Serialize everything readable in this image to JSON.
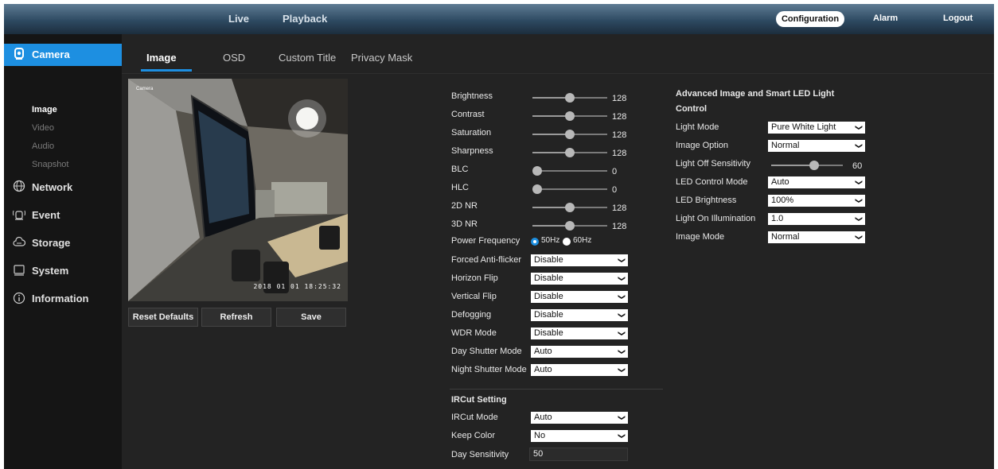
{
  "topnav": {
    "live": "Live",
    "playback": "Playback",
    "configuration": "Configuration",
    "alarm": "Alarm",
    "logout": "Logout"
  },
  "tabs": [
    "Image",
    "OSD",
    "Custom Title",
    "Privacy Mask"
  ],
  "sidebar": {
    "camera": "Camera",
    "camera_items": [
      "Image",
      "Video",
      "Audio",
      "Snapshot"
    ],
    "network": "Network",
    "event": "Event",
    "storage": "Storage",
    "system": "System",
    "information": "Information"
  },
  "preview": {
    "timestamp": "2018 01 01  18:25:32",
    "label": "Camera"
  },
  "buttons": {
    "reset": "Reset Defaults",
    "refresh": "Refresh",
    "save": "Save"
  },
  "image_settings": {
    "sliders": [
      {
        "label": "Brightness",
        "value": "128",
        "level": 0.5
      },
      {
        "label": "Contrast",
        "value": "128",
        "level": 0.5
      },
      {
        "label": "Saturation",
        "value": "128",
        "level": 0.5
      },
      {
        "label": "Sharpness",
        "value": "128",
        "level": 0.5
      },
      {
        "label": "BLC",
        "value": "0",
        "level": 0
      },
      {
        "label": "HLC",
        "value": "0",
        "level": 0
      },
      {
        "label": "2D NR",
        "value": "128",
        "level": 0.5
      },
      {
        "label": "3D NR",
        "value": "128",
        "level": 0.5
      }
    ],
    "power_frequency": {
      "label": "Power Frequency",
      "opt1": "50Hz",
      "opt2": "60Hz"
    },
    "selects": [
      {
        "label": "Forced Anti-flicker",
        "value": "Disable"
      },
      {
        "label": "Horizon Flip",
        "value": "Disable"
      },
      {
        "label": "Vertical Flip",
        "value": "Disable"
      },
      {
        "label": "Defogging",
        "value": "Disable"
      },
      {
        "label": "WDR Mode",
        "value": "Disable"
      },
      {
        "label": "Day Shutter Mode",
        "value": "Auto"
      },
      {
        "label": "Night Shutter Mode",
        "value": "Auto"
      }
    ]
  },
  "ircut": {
    "title": "IRCut Setting",
    "mode": {
      "label": "IRCut Mode",
      "value": "Auto"
    },
    "keep_color": {
      "label": "Keep Color",
      "value": "No"
    },
    "day_sensitivity": {
      "label": "Day Sensitivity",
      "value": "50"
    }
  },
  "advanced": {
    "title_line1": "Advanced Image and Smart LED Light",
    "title_line2": "Control",
    "light_mode": {
      "label": "Light Mode",
      "value": "Pure White Light"
    },
    "image_option": {
      "label": "Image Option",
      "value": "Normal"
    },
    "light_off_sensitivity": {
      "label": "Light Off Sensitivity",
      "value": "60",
      "level": 0.6
    },
    "led_control_mode": {
      "label": "LED Control Mode",
      "value": "Auto"
    },
    "led_brightness": {
      "label": "LED Brightness",
      "value": "100%"
    },
    "light_on_illumination": {
      "label": "Light On Illumination",
      "value": "1.0"
    },
    "image_mode": {
      "label": "Image Mode",
      "value": "Normal"
    }
  },
  "colors": {
    "accent": "#1d8fe1",
    "panel": "#232323",
    "sidebar": "#151515"
  }
}
